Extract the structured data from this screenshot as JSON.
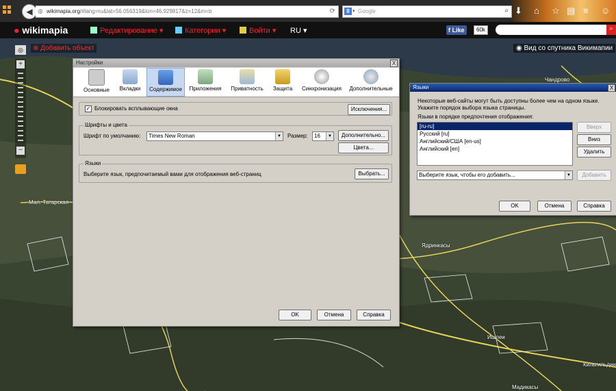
{
  "browser": {
    "url_domain": "wikimapia.org",
    "url_rest": "/#lang=ru&lat=56.056319&lon=46.929817&z=12&m=b",
    "search_placeholder": "Google",
    "search_engine_badge": "8"
  },
  "wikimapia": {
    "logo": "wikimapia",
    "menu": [
      {
        "label": "Редактирование ▾"
      },
      {
        "label": "Категории ▾"
      },
      {
        "label": "Войти ▾"
      }
    ],
    "lang": "RU ▾",
    "fb_like": "Like",
    "fb_count": "60k",
    "add_object": "Добавить объект",
    "satellite_view": "Вид со спутника Викимапии"
  },
  "map_labels": {
    "mal_tatarskaya": "Мал. Татарская",
    "yadrinkasy": "Ядринкасы",
    "ishlei": "Ишлеи",
    "madikasy": "Мадикасы",
    "chandrovo": "Чандрово",
    "kilgildino": "Кильгильдино"
  },
  "settings_dialog": {
    "title": "Настройки",
    "close": "X",
    "categories": [
      {
        "label": "Основные",
        "icon": "general-icon"
      },
      {
        "label": "Вкладки",
        "icon": "tabs-icon"
      },
      {
        "label": "Содержимое",
        "icon": "content-icon"
      },
      {
        "label": "Приложения",
        "icon": "applications-icon"
      },
      {
        "label": "Приватность",
        "icon": "privacy-mask-icon"
      },
      {
        "label": "Защита",
        "icon": "lock-icon"
      },
      {
        "label": "Синхронизация",
        "icon": "sync-icon"
      },
      {
        "label": "Дополнительные",
        "icon": "gear-icon"
      }
    ],
    "block_popups_label": "Блокировать всплывающие окна",
    "exceptions_button": "Исключения...",
    "fonts_group_title": "Шрифты и цвета",
    "default_font_label": "Шрифт по умолчанию:",
    "default_font_value": "Times New Roman",
    "size_label": "Размер:",
    "size_value": "16",
    "advanced_button": "Дополнительно...",
    "colors_button": "Цвета...",
    "languages_group_title": "Языки",
    "languages_desc": "Выберите язык, предпочитаемый вами для отображения веб-страниц",
    "choose_button": "Выбрать...",
    "ok": "OK",
    "cancel": "Отмена",
    "help": "Справка"
  },
  "languages_dialog": {
    "title": "Языки",
    "close": "X",
    "description_line1": "Некоторые веб-сайты могут быть доступны более чем на одном языке.",
    "description_line2": "Укажите порядок выбора языка страницы.",
    "list_label": "Языки в порядке предпочтения отображения:",
    "languages": [
      "[ru-ru]",
      "Русский  [ru]",
      "Английский/США  [en-us]",
      "Английский  [en]"
    ],
    "up_button": "Вверх",
    "down_button": "Вниз",
    "remove_button": "Удалить",
    "add_select_placeholder": "Выберите язык, чтобы его добавить...",
    "add_button": "Добавить",
    "ok": "OK",
    "cancel": "Отмена",
    "help": "Справка"
  }
}
